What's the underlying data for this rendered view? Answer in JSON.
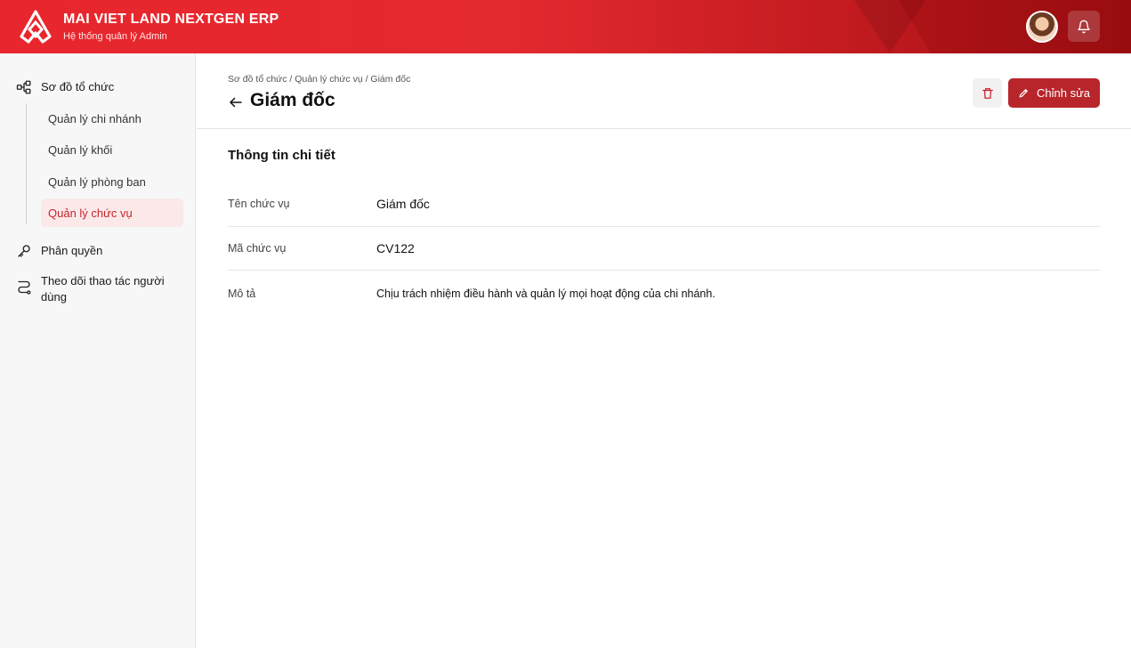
{
  "header": {
    "title": "MAI VIET LAND NEXTGEN ERP",
    "subtitle": "Hệ thống quản lý Admin",
    "logo_icon": "triangle-logo-icon",
    "notification_icon": "bell-icon",
    "brand_color": "#e32a2f"
  },
  "sidebar": {
    "groups": [
      {
        "label": "Sơ đồ tổ chức",
        "icon": "org-chart-icon"
      },
      {
        "label": "Phân quyền",
        "icon": "key-icon"
      },
      {
        "label": "Theo dõi thao tác người dùng",
        "icon": "route-icon"
      }
    ],
    "sub_items": [
      {
        "label": "Quản lý chi nhánh",
        "active": false
      },
      {
        "label": "Quản lý khối",
        "active": false
      },
      {
        "label": "Quản lý phòng ban",
        "active": false
      },
      {
        "label": "Quản lý chức vụ",
        "active": true
      }
    ],
    "active_color": "#c8242b"
  },
  "main": {
    "breadcrumb": "Sơ đồ tổ chức / Quản lý chức vụ / Giám đốc",
    "title": "Giám đốc",
    "edit_label": "Chỉnh sửa",
    "section_title": "Thông tin chi tiết",
    "fields": [
      {
        "label": "Tên chức vụ",
        "value": "Giám đốc"
      },
      {
        "label": "Mã chức vụ",
        "value": "CV122"
      },
      {
        "label": "Mô tả",
        "value": "Chịu trách nhiệm điều hành và quản lý mọi hoạt động của chi nhánh."
      }
    ]
  }
}
